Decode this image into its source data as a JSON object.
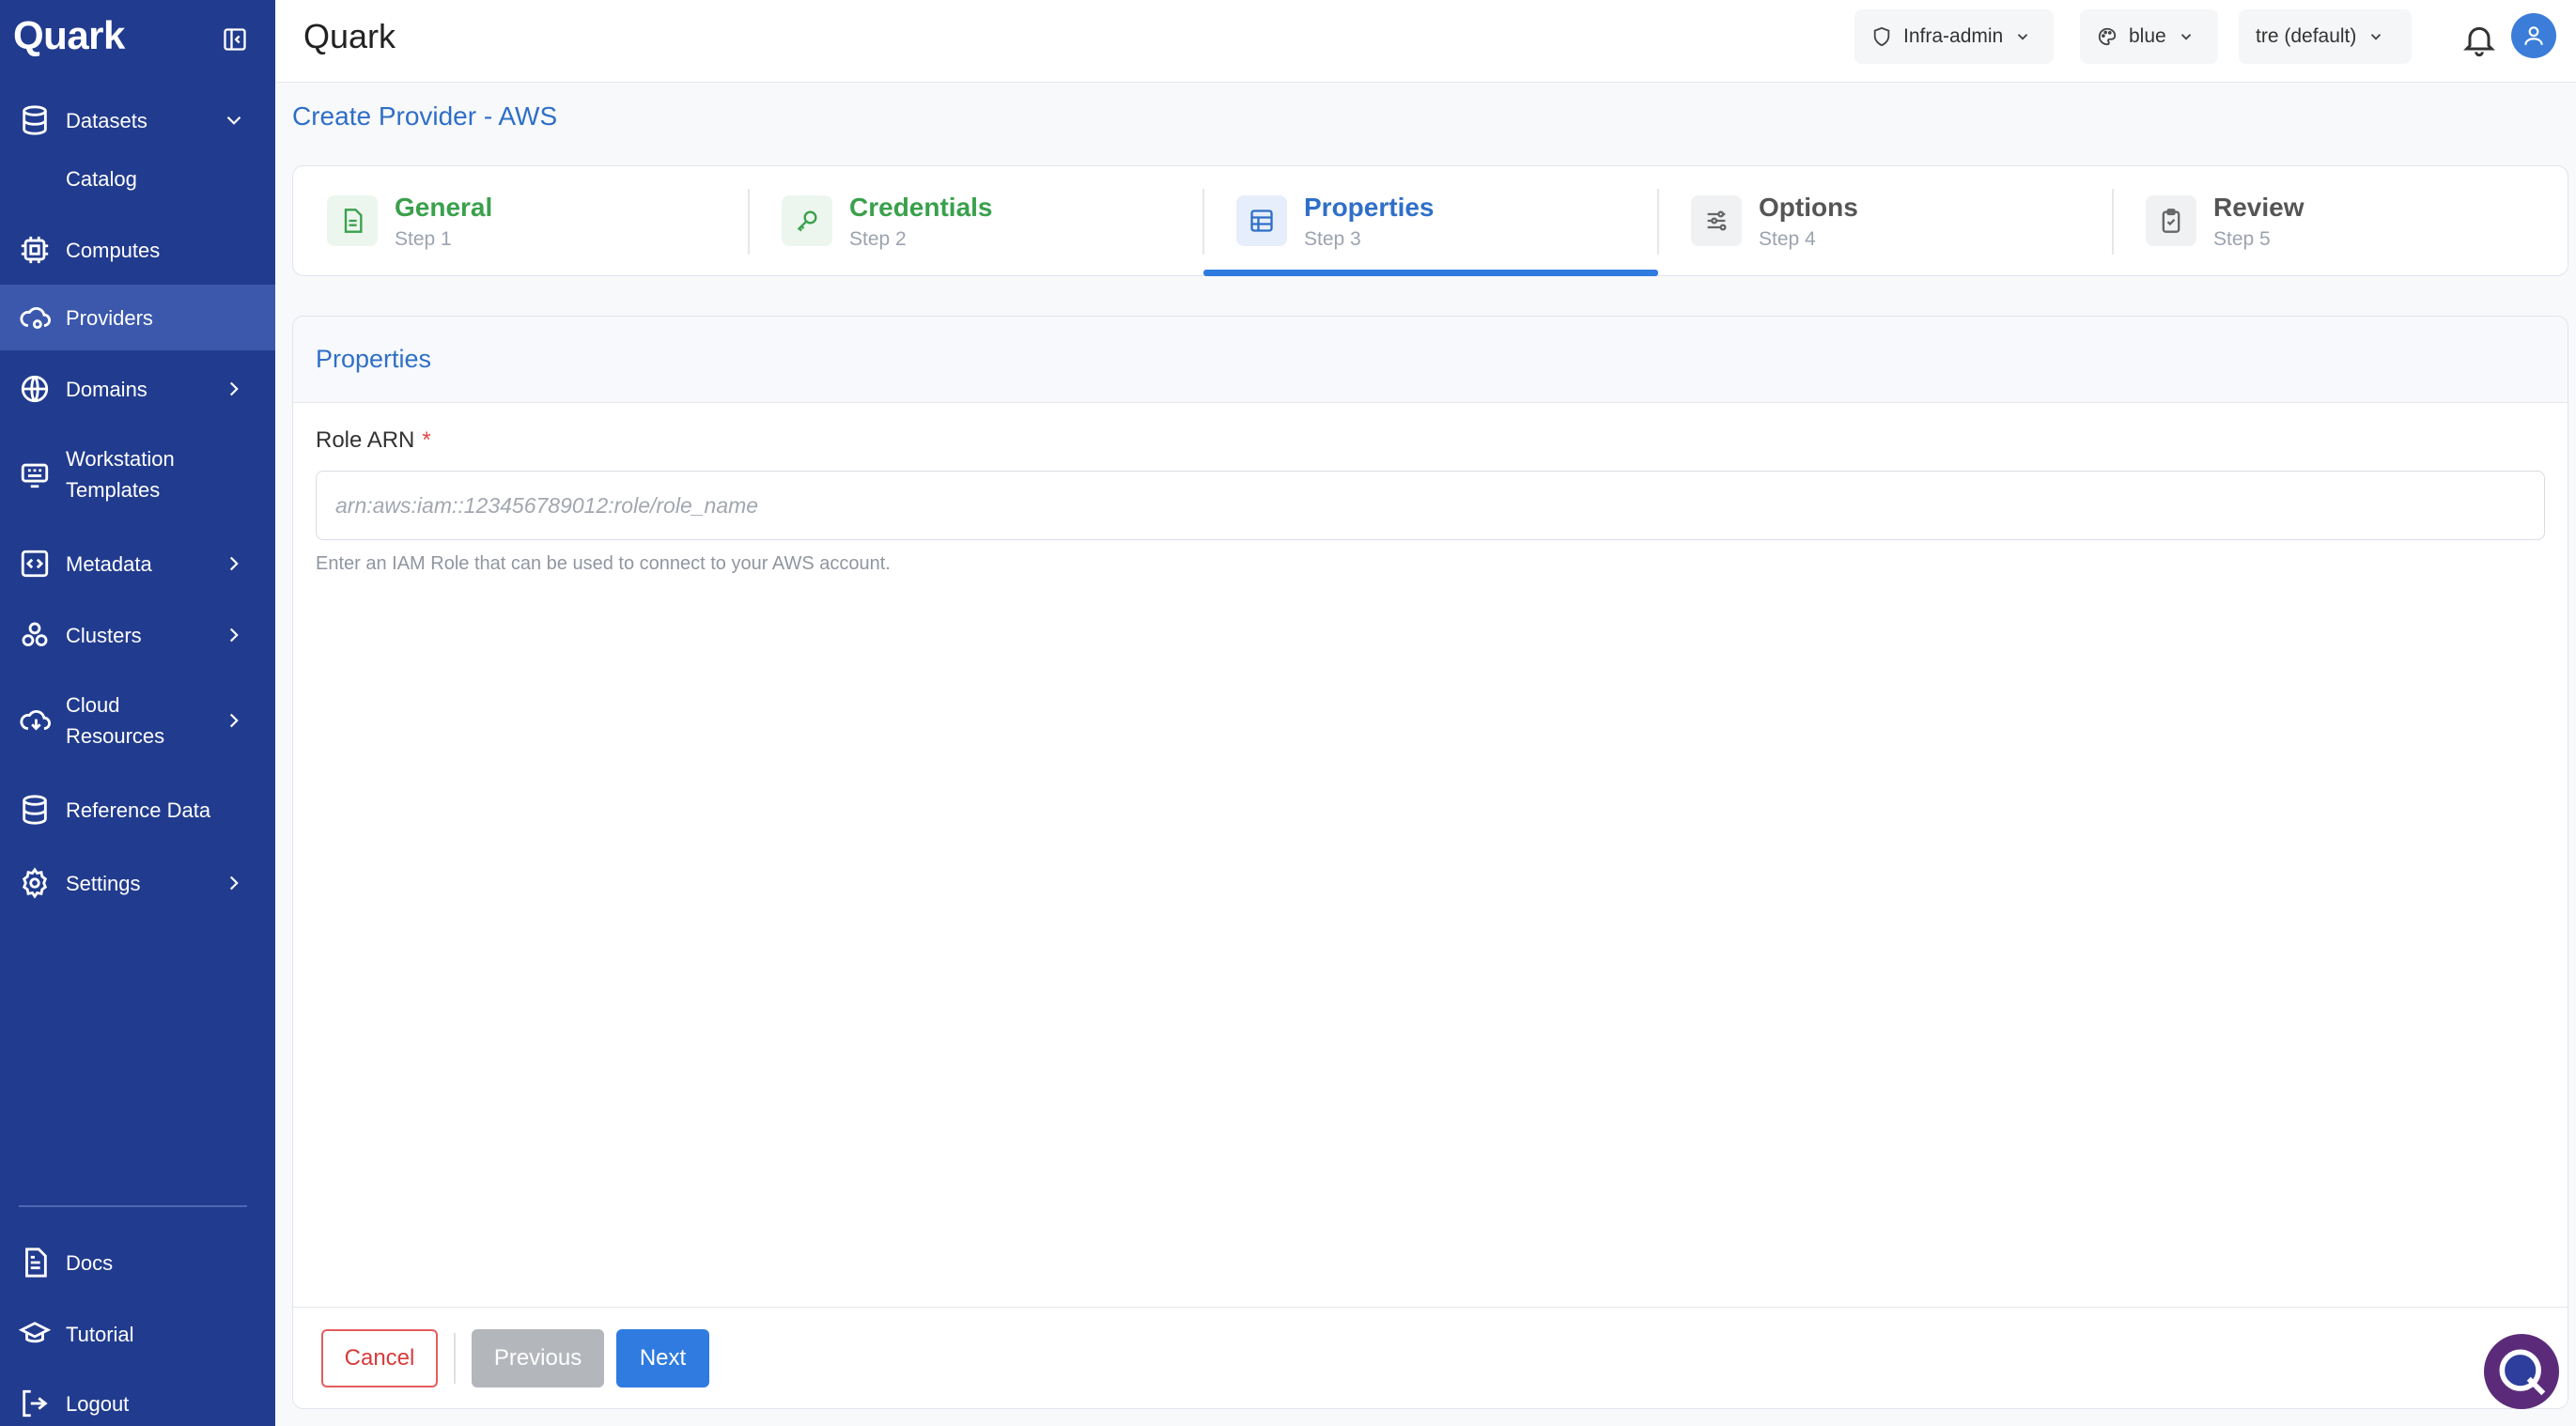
{
  "app": {
    "brand": "Quark",
    "title": "Quark"
  },
  "sidebar": {
    "items": [
      {
        "label": "Datasets",
        "icon": "database-icon",
        "chevron": "down"
      },
      {
        "label": "Catalog",
        "sub": true
      },
      {
        "label": "Computes",
        "icon": "cpu-icon"
      },
      {
        "label": "Providers",
        "icon": "cloud-gear-icon",
        "active": true
      },
      {
        "label": "Domains",
        "icon": "globe-icon",
        "chevron": "right"
      },
      {
        "label": "Workstation Templates",
        "icon": "workstation-icon"
      },
      {
        "label": "Metadata",
        "icon": "code-icon",
        "chevron": "right"
      },
      {
        "label": "Clusters",
        "icon": "cluster-icon",
        "chevron": "right"
      },
      {
        "label": "Cloud Resources",
        "icon": "cloud-download-icon",
        "chevron": "right"
      },
      {
        "label": "Reference Data",
        "icon": "database-icon"
      },
      {
        "label": "Settings",
        "icon": "gear-icon",
        "chevron": "right"
      }
    ],
    "footer": [
      {
        "label": "Docs",
        "icon": "document-icon"
      },
      {
        "label": "Tutorial",
        "icon": "graduation-cap-icon"
      },
      {
        "label": "Logout",
        "icon": "logout-icon"
      }
    ]
  },
  "header": {
    "role": "Infra-admin",
    "theme": "blue",
    "tenant": "tre (default)"
  },
  "page": {
    "title": "Create Provider - AWS"
  },
  "steps": [
    {
      "title": "General",
      "sub": "Step 1",
      "state": "done"
    },
    {
      "title": "Credentials",
      "sub": "Step 2",
      "state": "done"
    },
    {
      "title": "Properties",
      "sub": "Step 3",
      "state": "current"
    },
    {
      "title": "Options",
      "sub": "Step 4",
      "state": "future"
    },
    {
      "title": "Review",
      "sub": "Step 5",
      "state": "future"
    }
  ],
  "form": {
    "section_title": "Properties",
    "role_arn": {
      "label": "Role ARN",
      "required_mark": "*",
      "placeholder": "arn:aws:iam::123456789012:role/role_name",
      "value": "",
      "help": "Enter an IAM Role that can be used to connect to your AWS account."
    }
  },
  "actions": {
    "cancel": "Cancel",
    "previous": "Previous",
    "next": "Next"
  },
  "colors": {
    "sidebar": "#213b8e",
    "active": "#3b58ad",
    "primary": "#2f7be0",
    "success": "#3aa04c",
    "danger": "#d83b3b"
  }
}
